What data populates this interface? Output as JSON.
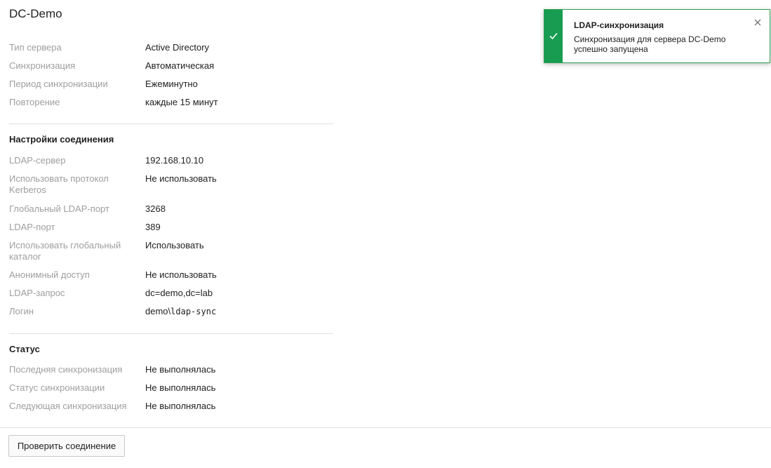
{
  "page": {
    "title": "DC-Demo"
  },
  "general": [
    {
      "label": "Тип сервера",
      "value": "Active Directory"
    },
    {
      "label": "Синхронизация",
      "value": "Автоматическая"
    },
    {
      "label": "Период синхронизации",
      "value": "Ежеминутно"
    },
    {
      "label": "Повторение",
      "value": "каждые 15 минут"
    }
  ],
  "connection": {
    "title": "Настройки соединения",
    "rows": [
      {
        "label": "LDAP-сервер",
        "value": "192.168.10.10"
      },
      {
        "label": "Использовать протокол Kerberos",
        "value": "Не использовать"
      },
      {
        "label": "Глобальный LDAP-порт",
        "value": "3268"
      },
      {
        "label": "LDAP-порт",
        "value": "389"
      },
      {
        "label": "Использовать глобальный каталог",
        "value": "Использовать"
      },
      {
        "label": "Анонимный доступ",
        "value": "Не использовать"
      },
      {
        "label": "LDAP-запрос",
        "value": "dc=demo,dc=lab"
      },
      {
        "label": "Логин",
        "value_prefix": "demo\\",
        "value_mono": "ldap-sync"
      }
    ]
  },
  "status": {
    "title": "Статус",
    "rows": [
      {
        "label": "Последняя синхронизация",
        "value": "Не выполнялась"
      },
      {
        "label": "Статус синхронизации",
        "value": "Не выполнялась"
      },
      {
        "label": "Следующая синхронизация",
        "value": "Не выполнялась"
      }
    ]
  },
  "footer": {
    "check_button": "Проверить соединение"
  },
  "toast": {
    "title": "LDAP-синхронизация",
    "message": "Синхронизация для сервера DC-Demo успешно запущена",
    "status_icon": "check-icon",
    "close_icon": "close-icon",
    "accent_color": "#179c52"
  }
}
